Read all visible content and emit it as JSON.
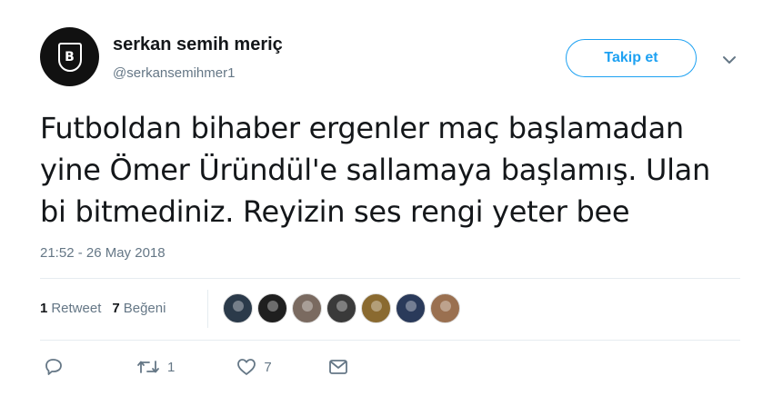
{
  "author": {
    "name": "serkan semih meriç",
    "handle": "@serkansemihmer1",
    "avatar_icon": "team-crest-icon"
  },
  "follow_button": {
    "label": "Takip et"
  },
  "menu_icon": "chevron-down-icon",
  "tweet": {
    "lines": [
      "Futboldan bihaber ergenler maç başlamadan",
      "yine Ömer Üründül'e sallamaya başlamış. Ulan",
      "bi bitmediniz. Reyizin ses rengi yeter bee"
    ],
    "timestamp": "21:52 - 26 May 2018"
  },
  "stats": {
    "retweets_count": "1",
    "retweets_label": "Retweet",
    "likes_count": "7",
    "likes_label": "Beğeni"
  },
  "likers": [
    {
      "color": "#2b3a4a"
    },
    {
      "color": "#1f1f1f"
    },
    {
      "color": "#7a6a60"
    },
    {
      "color": "#3a3a3a"
    },
    {
      "color": "#8a6a30"
    },
    {
      "color": "#2a3a5a"
    },
    {
      "color": "#9a7050"
    }
  ],
  "actions": {
    "reply_icon": "reply-icon",
    "retweet_icon": "retweet-icon",
    "retweet_count": "1",
    "like_icon": "heart-icon",
    "like_count": "7",
    "message_icon": "envelope-icon"
  },
  "colors": {
    "accent": "#1da1f2",
    "text": "#14171a",
    "muted": "#657786"
  }
}
